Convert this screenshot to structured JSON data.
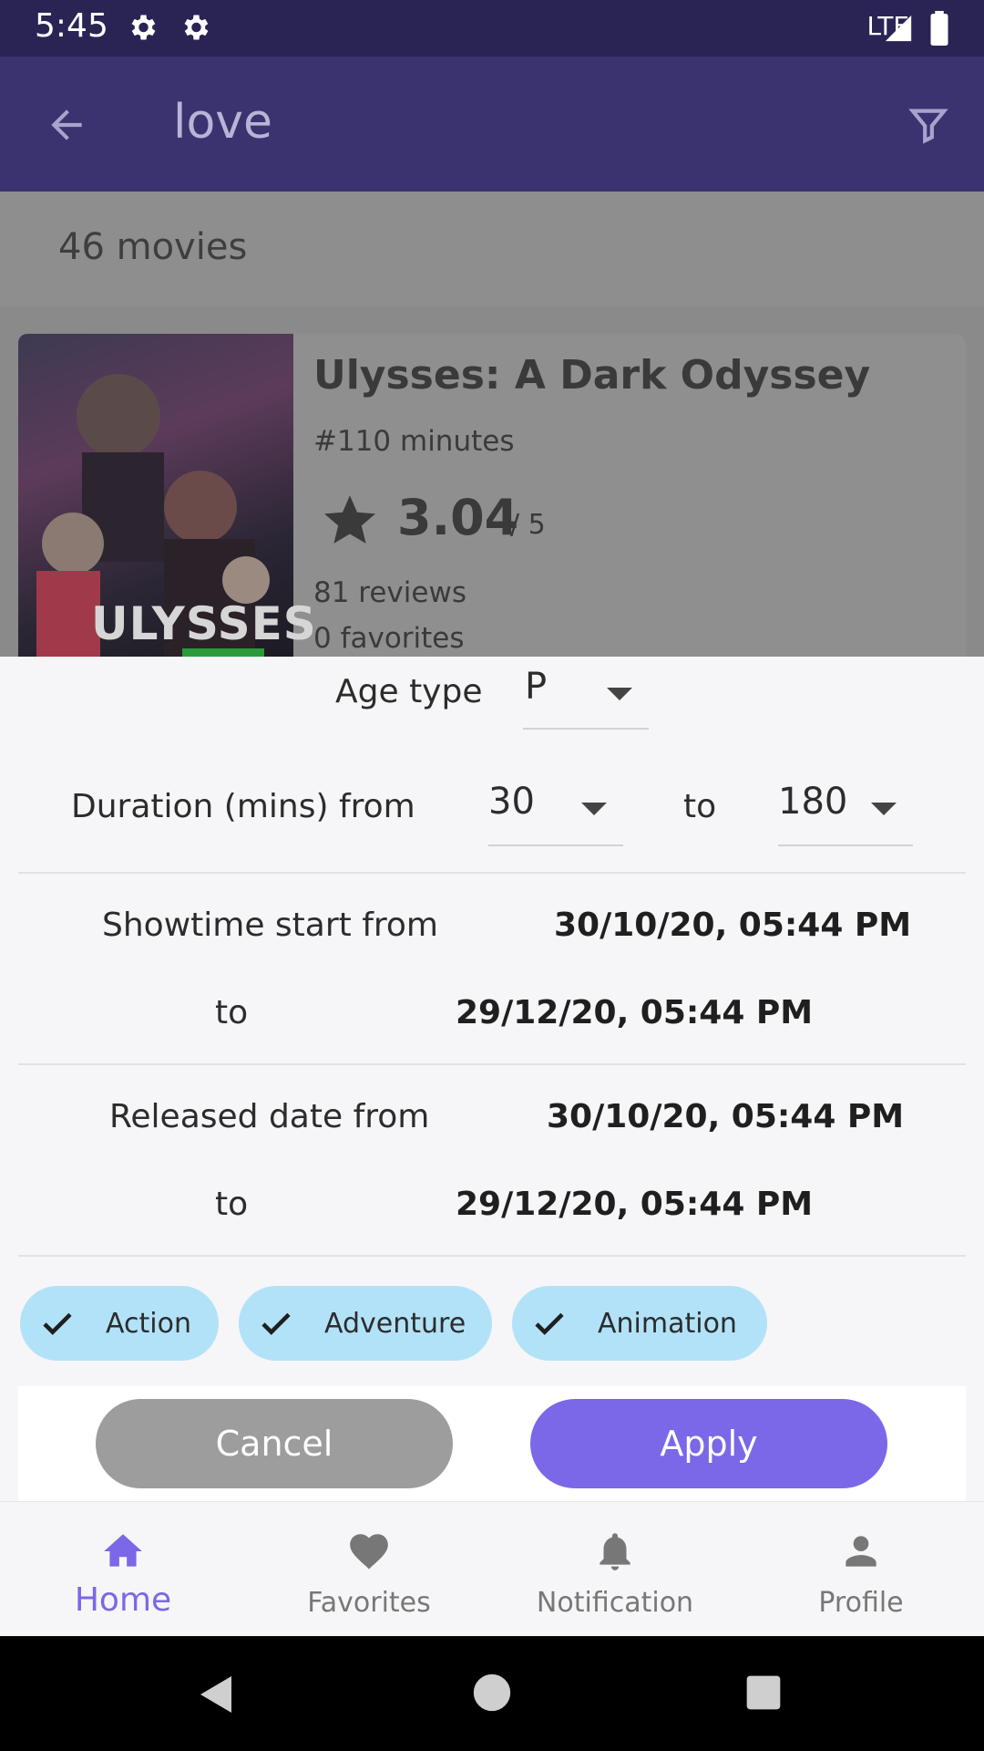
{
  "status_bar": {
    "time": "5:45",
    "network": "LTE"
  },
  "app_bar": {
    "query": "love"
  },
  "results": {
    "count_text": "46 movies"
  },
  "movie": {
    "poster_text": "ULYSSES",
    "title": "Ulysses: A Dark Odyssey",
    "duration": "#110 minutes",
    "rating": "3.04",
    "rating_max": "/ 5",
    "reviews": "81 reviews",
    "favorites": "0 favorites"
  },
  "filter": {
    "age_type_label": "Age type",
    "age_type_value": "P",
    "duration_label": "Duration (mins) from",
    "duration_from": "30",
    "duration_to_label": "to",
    "duration_to": "180",
    "showtime_label": "Showtime start from",
    "showtime_from": "30/10/20, 05:44 PM",
    "showtime_to_label": "to",
    "showtime_to": "29/12/20, 05:44 PM",
    "released_label": "Released date from",
    "released_from": "30/10/20, 05:44 PM",
    "released_to_label": "to",
    "released_to": "29/12/20, 05:44 PM",
    "genres": [
      "Action",
      "Adventure",
      "Animation"
    ],
    "cancel": "Cancel",
    "apply": "Apply"
  },
  "nav": {
    "items": [
      {
        "label": "Home",
        "icon": "home-icon",
        "active": true
      },
      {
        "label": "Favorites",
        "icon": "heart-icon",
        "active": false
      },
      {
        "label": "Notification",
        "icon": "bell-icon",
        "active": false
      },
      {
        "label": "Profile",
        "icon": "person-icon",
        "active": false
      }
    ]
  },
  "colors": {
    "accent": "#7a68e8",
    "app_bar": "#3b3270",
    "chip": "#b2e2f8"
  }
}
